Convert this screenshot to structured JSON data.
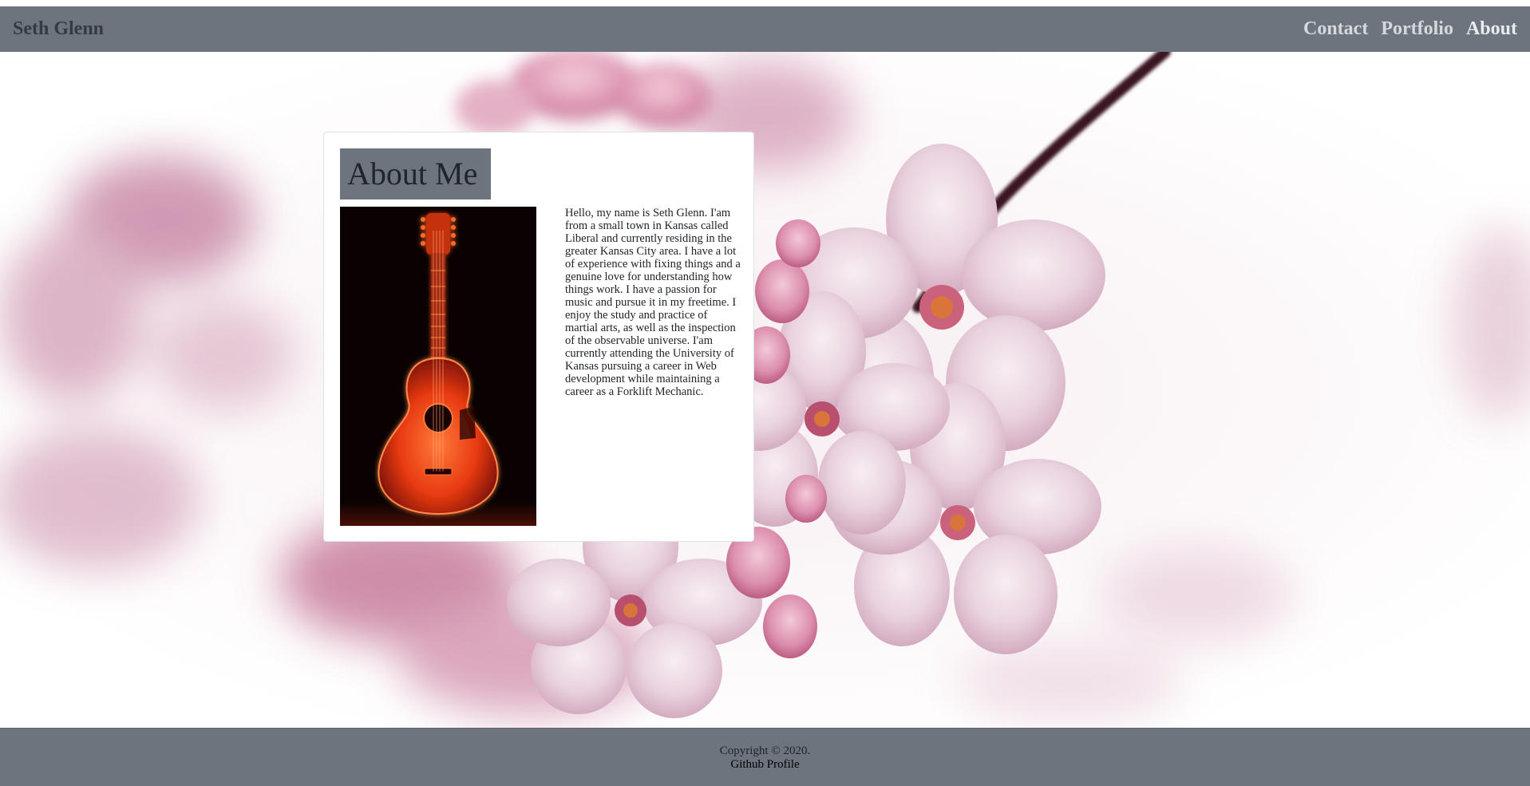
{
  "navbar": {
    "brand": "Seth Glenn",
    "links": [
      {
        "label": "Contact"
      },
      {
        "label": "Portfolio"
      },
      {
        "label": "About"
      }
    ]
  },
  "about": {
    "title": "About Me",
    "image": "acoustic-guitar-photo",
    "bio": "Hello, my name is Seth Glenn. I'am from a small town in Kansas called Liberal and currently residing in the greater Kansas City area. I have a lot of experience with fixing things and a genuine love for understanding how things work. I have a passion for music and pursue it in my freetime. I enjoy the study and practice of martial arts, as well as the inspection of the observable universe. I'am currently attending the University of Kansas pursuing a career in Web development while maintaining a career as a Forklift Mechanic."
  },
  "footer": {
    "copyright": "Copyright © 2020.",
    "github_label": "Github Profile"
  },
  "colors": {
    "navbar_bg": "#6c757d",
    "brand": "#343a40",
    "nav_link": "#d6d8db",
    "blossom_pink": "#e8c3d4",
    "blossom_dark": "#b8577e",
    "guitar_glow": "#ff4a1c"
  }
}
